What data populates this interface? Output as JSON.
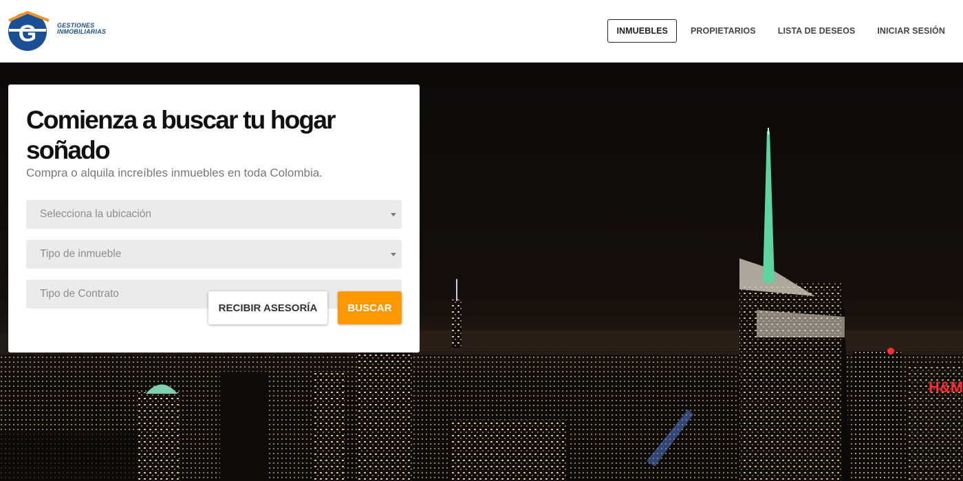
{
  "brand": {
    "line1": "GESTIONES",
    "line2": "INMOBILIARIAS",
    "logo_icon": "house-g-logo-icon",
    "colors": {
      "blue": "#1a4f95",
      "orange": "#f0922a"
    }
  },
  "nav": {
    "items": [
      {
        "label": "INMUEBLES",
        "active": true
      },
      {
        "label": "PROPIETARIOS",
        "active": false
      },
      {
        "label": "LISTA DE DESEOS",
        "active": false
      },
      {
        "label": "INICIAR SESIÓN",
        "active": false
      }
    ]
  },
  "search": {
    "title": "Comienza a buscar tu hogar soñado",
    "subtitle": "Compra o alquila increíbles inmuebles en toda Colombia.",
    "location_placeholder": "Selecciona la ubicación",
    "property_type_placeholder": "Tipo de inmueble",
    "contract_type_placeholder": "Tipo de Contrato",
    "advice_button": "RECIBIR ASESORÍA",
    "search_button": "BUSCAR"
  },
  "theme": {
    "accent": "#ff9800",
    "header_bg": "#ffffff"
  }
}
